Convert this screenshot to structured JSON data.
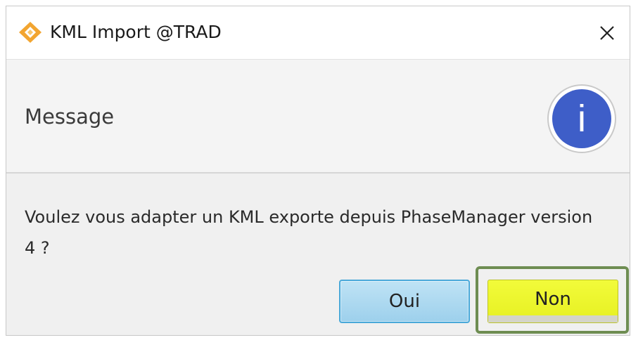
{
  "window": {
    "title": "KML Import @TRAD",
    "close_glyph": "✕"
  },
  "header": {
    "title": "Message",
    "icon_letter": "i"
  },
  "body": {
    "message": "Voulez vous adapter un KML exporte depuis PhaseManager version 4 ?"
  },
  "buttons": {
    "yes_label": "Oui",
    "no_label": "Non"
  },
  "colors": {
    "app_icon": "#f2a530",
    "info_icon": "#3e5ec8",
    "yes_button": "#a9d7ef",
    "no_button": "#ecf52c",
    "focus_ring": "#6e8d52"
  },
  "icons": {
    "app": "diamond-logo-icon",
    "close": "close-icon",
    "info": "info-icon"
  }
}
